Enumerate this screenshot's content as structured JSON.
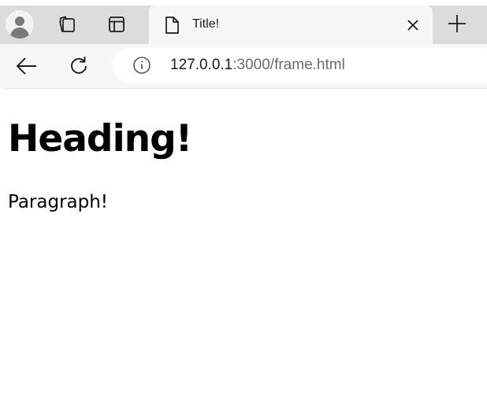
{
  "browser": {
    "tab": {
      "title": "Title!"
    },
    "address_bar": {
      "host": "127.0.0.1",
      "path": ":3000/frame.html"
    },
    "icons": {
      "profile": "profile-avatar-icon",
      "workspaces": "workspaces-icon",
      "tab_actions": "vertical-tabs-icon",
      "page": "document-icon",
      "close": "close-icon",
      "new_tab": "plus-icon",
      "back": "back-arrow-icon",
      "refresh": "refresh-icon",
      "site_info": "info-icon"
    }
  },
  "page": {
    "heading": "Heading!",
    "paragraph": "Paragraph!"
  }
}
